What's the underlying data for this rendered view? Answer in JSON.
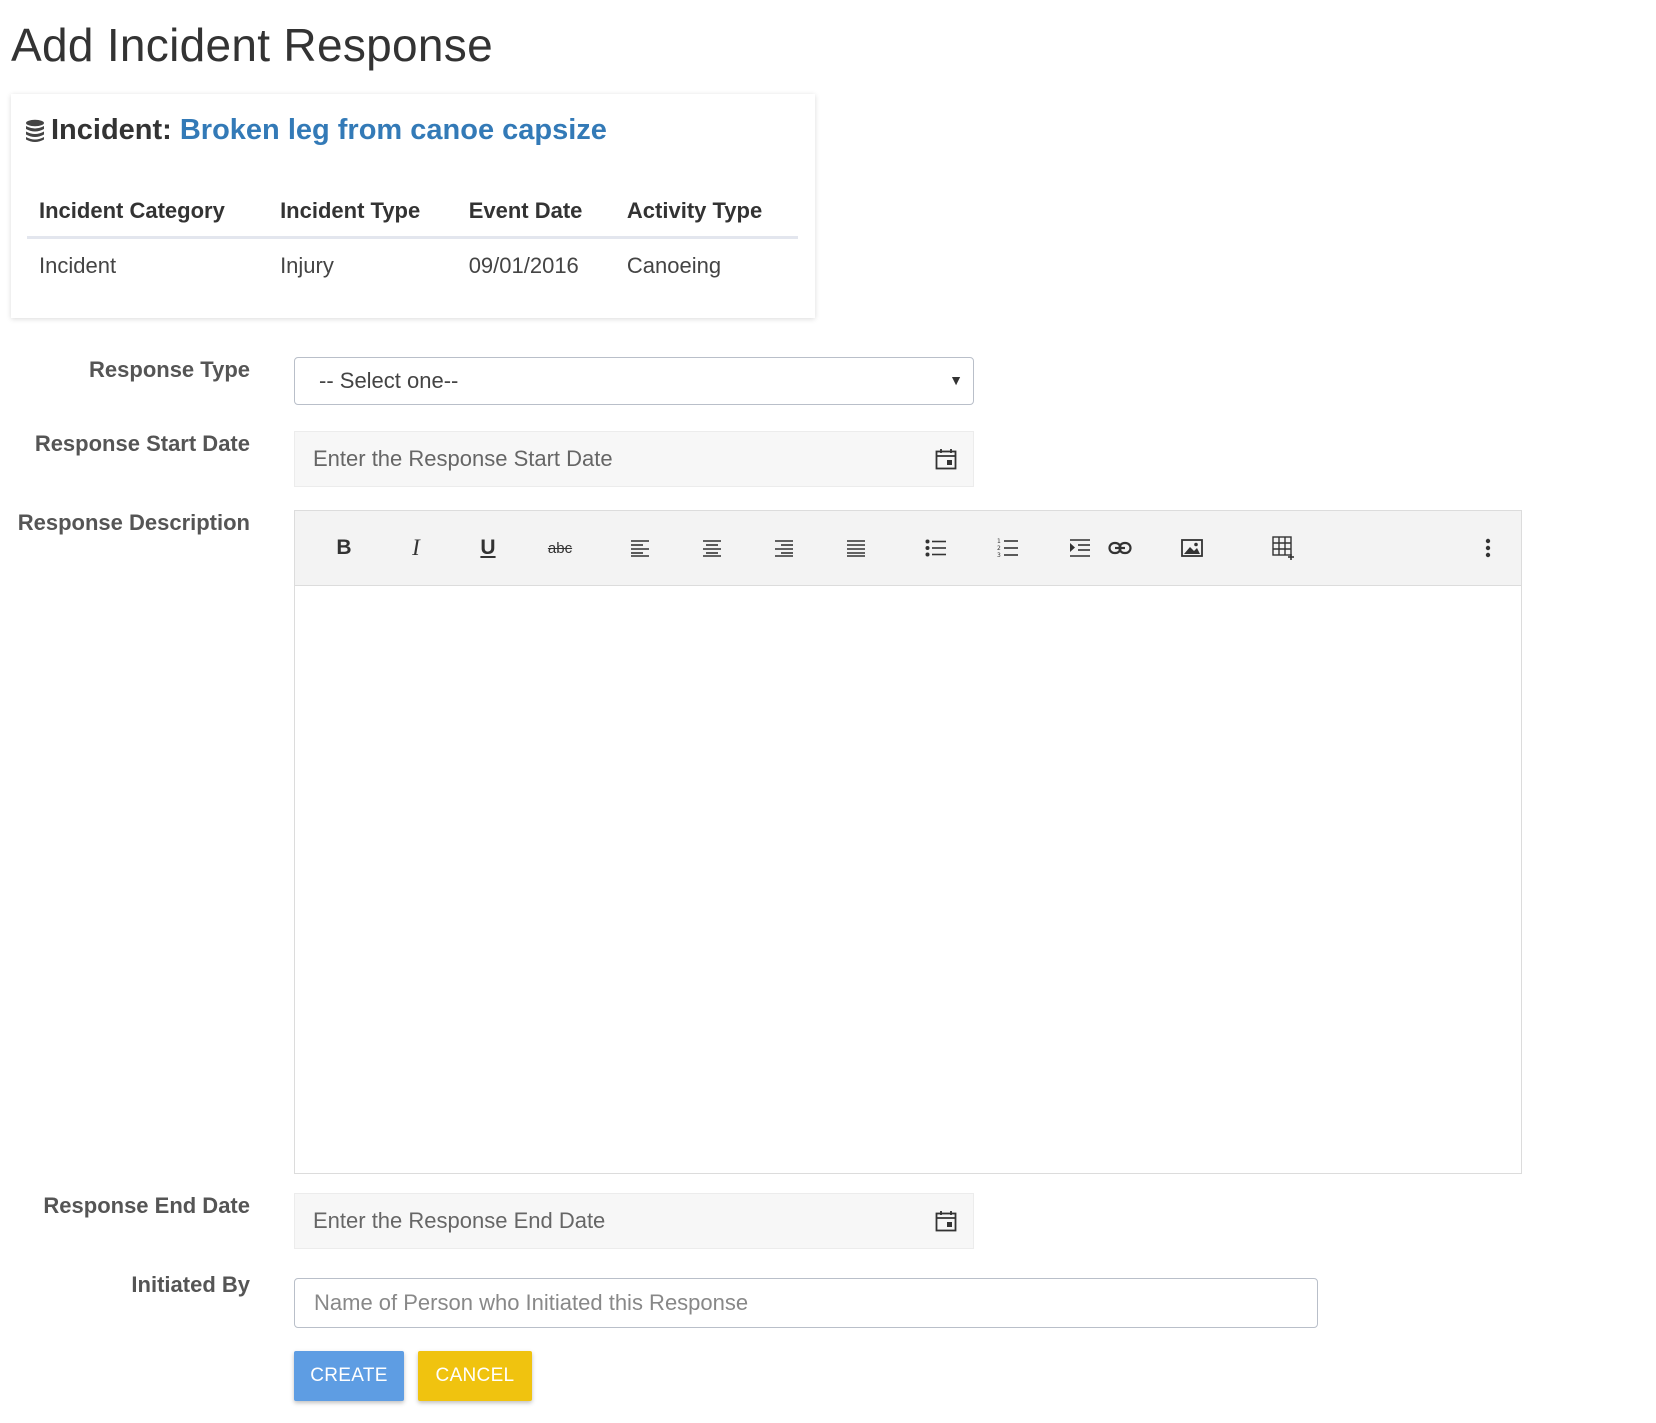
{
  "page": {
    "title": "Add Incident Response"
  },
  "incident": {
    "prefix": "Incident:",
    "name": "Broken leg from canoe capsize",
    "columns": [
      "Incident Category",
      "Incident Type",
      "Event Date",
      "Activity Type"
    ],
    "row": [
      "Incident",
      "Injury",
      "09/01/2016",
      "Canoeing"
    ]
  },
  "form": {
    "response_type": {
      "label": "Response Type",
      "selected": "-- Select one--"
    },
    "response_start_date": {
      "label": "Response Start Date",
      "placeholder": "Enter the Response Start Date"
    },
    "response_description": {
      "label": "Response Description",
      "toolbar": [
        {
          "name": "bold-button",
          "glyph": "B",
          "icon": "bold-icon"
        },
        {
          "name": "italic-button",
          "glyph": "I",
          "icon": "italic-icon"
        },
        {
          "name": "underline-button",
          "glyph": "U",
          "icon": "underline-icon"
        },
        {
          "name": "strikethrough-button",
          "glyph": "abc",
          "icon": "strikethrough-icon"
        },
        {
          "name": "align-left-button",
          "icon": "align-left-icon"
        },
        {
          "name": "align-center-button",
          "icon": "align-center-icon"
        },
        {
          "name": "align-right-button",
          "icon": "align-right-icon"
        },
        {
          "name": "align-justify-button",
          "icon": "align-justify-icon"
        },
        {
          "name": "bullet-list-button",
          "icon": "bullet-list-icon"
        },
        {
          "name": "numbered-list-button",
          "icon": "numbered-list-icon"
        },
        {
          "name": "indent-button",
          "icon": "indent-icon"
        },
        {
          "name": "link-button",
          "icon": "link-icon"
        },
        {
          "name": "image-button",
          "icon": "image-icon"
        },
        {
          "name": "table-button",
          "icon": "table-icon"
        },
        {
          "name": "more-button",
          "icon": "more-vertical-icon"
        }
      ]
    },
    "response_end_date": {
      "label": "Response End Date",
      "placeholder": "Enter the Response End Date"
    },
    "initiated_by": {
      "label": "Initiated By",
      "placeholder": "Name of Person who Initiated this Response"
    },
    "buttons": {
      "create": "CREATE",
      "cancel": "CANCEL"
    }
  },
  "colors": {
    "link": "#337ab7",
    "create_button": "#5e9de3",
    "cancel_button": "#f0c30f"
  }
}
